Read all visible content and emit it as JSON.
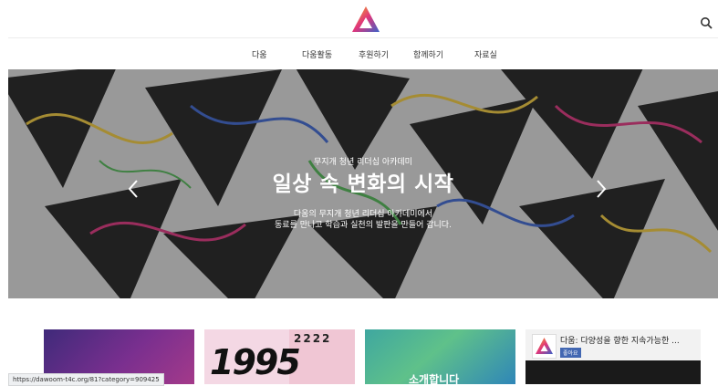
{
  "nav": {
    "items": [
      "다움",
      "다움활동",
      "후원하기",
      "함께하기",
      "자료실"
    ]
  },
  "hero": {
    "subtitle": "무지개 청년 리더십 아카데미",
    "title": "일상 속 변화의 시작",
    "desc_line1": "다움의 무지개 청년 리더십 아카데미에서",
    "desc_line2": "동료를 만나고 학습과 실천의 발판을 만들어 갑니다."
  },
  "cards": {
    "card2_year": "1995",
    "card2_mini": "2222",
    "card3_text": "소개합니다",
    "card4_title": "다움: 다양성을 향한 지속가능한 ...",
    "card4_like": "좋아요"
  },
  "status_url": "https://dawoom-t4c.org/81?category=909425",
  "colors": {
    "accent_orange": "#f0a21d",
    "accent_pink": "#d8317a",
    "accent_blue": "#3a67c8"
  }
}
